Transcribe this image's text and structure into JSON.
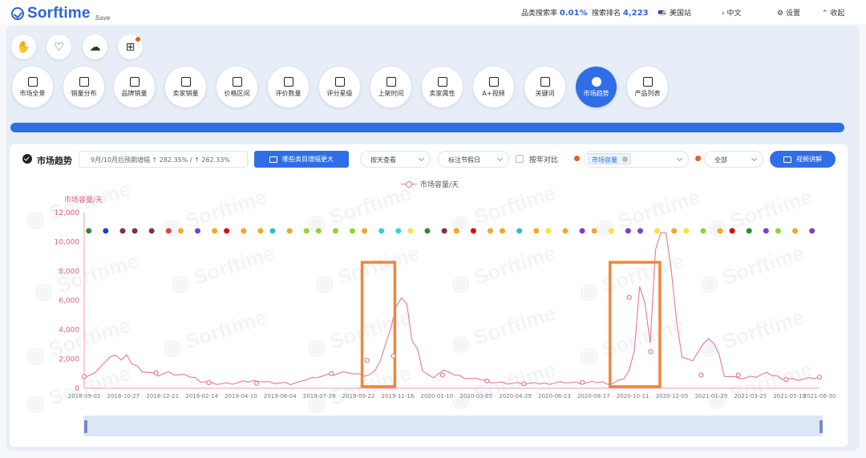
{
  "app": {
    "logo": "Sorftime",
    "logo_sub": "Save"
  },
  "topbar": {
    "search_rate_label": "品类搜索率",
    "search_rate_value": "0.01%",
    "search_rank_label": "搜索排名",
    "search_rank_value": "4,223",
    "site_label": "美国站",
    "lang_label": "中文",
    "settings_label": "设置",
    "collapse_label": "收起"
  },
  "nav": {
    "items": [
      {
        "label": "市场全景",
        "icon": "grid-icon"
      },
      {
        "label": "销量分布",
        "icon": "bar-chart-icon"
      },
      {
        "label": "品牌销量",
        "icon": "brand-shield-icon"
      },
      {
        "label": "卖家销量",
        "icon": "seller-icon"
      },
      {
        "label": "价格区间",
        "icon": "price-icon"
      },
      {
        "label": "评价数量",
        "icon": "review-icon"
      },
      {
        "label": "评分星级",
        "icon": "star-icon"
      },
      {
        "label": "上架时间",
        "icon": "calendar-icon"
      },
      {
        "label": "卖家属性",
        "icon": "store-icon"
      },
      {
        "label": "A+视频",
        "icon": "video-icon"
      },
      {
        "label": "关键词",
        "icon": "lock-icon"
      },
      {
        "label": "市场趋势",
        "icon": "trend-icon"
      },
      {
        "label": "产品列表",
        "icon": "list-icon"
      }
    ],
    "active_index": 11
  },
  "progress": {
    "value": 1.0
  },
  "card": {
    "title": "市场趋势",
    "info_text": "9月/10月后预期增幅 ↑ 282.35% / ↑ 262.33%",
    "growth_button": "哪些类目增幅更大",
    "granularity_select": "按天查看",
    "holiday_select": "标注节假日",
    "yoy_label": "按年对比",
    "metric_tag": "市场容量",
    "scope_select": "全部",
    "video_button": "视频讲解"
  },
  "chart_data": {
    "type": "line",
    "series": [
      {
        "name": "市场容量/天"
      }
    ],
    "ylabel": "市场容量/天",
    "ylim": [
      0,
      12000
    ],
    "yticks": [
      "0",
      "2,000",
      "4,000",
      "6,000",
      "8,000",
      "10,000",
      "12,000"
    ],
    "x_ticks": [
      "2018-09-02",
      "2018-10-27",
      "2018-12-21",
      "2019-02-14",
      "2019-04-10",
      "2019-06-04",
      "2019-07-29",
      "2019-09-22",
      "2019-11-16",
      "2020-01-10",
      "2020-03-05",
      "2020-04-29",
      "2020-06-23",
      "2020-08-17",
      "2020-10-11",
      "2020-12-05",
      "2021-01-29",
      "2021-03-25",
      "2021-05-19",
      "2021-06-30"
    ],
    "x_range": [
      "2018-09-02",
      "2021-06-30"
    ],
    "values": [
      800,
      900,
      1000,
      1500,
      1800,
      2100,
      2300,
      1900,
      2200,
      1700,
      1500,
      1200,
      1100,
      1000,
      900,
      1000,
      1050,
      950,
      900,
      850,
      800,
      700,
      500,
      450,
      350,
      330,
      300,
      300,
      320,
      350,
      420,
      450,
      500,
      550,
      450,
      400,
      380,
      350,
      330,
      300,
      350,
      400,
      600,
      700,
      800,
      850,
      900,
      950,
      1000,
      1050,
      1100,
      950,
      900,
      850,
      900,
      1300,
      1900,
      3000,
      4200,
      5600,
      6100,
      5800,
      3200,
      2600,
      1200,
      900,
      800,
      1000,
      1200,
      1150,
      900,
      800,
      700,
      650,
      600,
      600,
      500,
      450,
      400,
      380,
      350,
      330,
      320,
      310,
      300,
      300,
      320,
      330,
      350,
      380,
      400,
      420,
      380,
      350,
      330,
      350,
      380,
      420,
      400,
      350,
      350,
      500,
      700,
      1200,
      2500,
      7000,
      5800,
      3000,
      9500,
      10600,
      10700,
      8000,
      4500,
      2200,
      2000,
      1800,
      2500,
      3000,
      3300,
      3100,
      2300,
      900,
      800,
      750,
      700,
      700,
      750,
      800,
      900,
      1000,
      900,
      800,
      700,
      650,
      600,
      600,
      620,
      650,
      700,
      750
    ],
    "markers": [
      {
        "date": "2018-09-02",
        "value": 800
      },
      {
        "date": "2018-12-12",
        "value": 1050
      },
      {
        "date": "2019-02-24",
        "value": 380
      },
      {
        "date": "2019-05-02",
        "value": 330
      },
      {
        "date": "2019-08-15",
        "value": 1000
      },
      {
        "date": "2019-10-04",
        "value": 1900
      },
      {
        "date": "2019-11-10",
        "value": 2200
      },
      {
        "date": "2020-01-18",
        "value": 900
      },
      {
        "date": "2020-03-20",
        "value": 500
      },
      {
        "date": "2020-05-11",
        "value": 300
      },
      {
        "date": "2020-08-01",
        "value": 400
      },
      {
        "date": "2020-10-06",
        "value": 6200
      },
      {
        "date": "2020-11-05",
        "value": 2500
      },
      {
        "date": "2021-01-15",
        "value": 900
      },
      {
        "date": "2021-03-08",
        "value": 900
      },
      {
        "date": "2021-05-14",
        "value": 600
      },
      {
        "date": "2021-06-30",
        "value": 750
      }
    ],
    "event_colors": [
      "#2e8b2e",
      "#1f3fd1",
      "#8b2e2e",
      "#8b2e2e",
      "#8b2e2e",
      "#e04040",
      "#f5a623",
      "#7b3fd1",
      "#f5a623",
      "#e00000",
      "#f5a623",
      "#f5a623",
      "#2fbfbf",
      "#f5a623",
      "#8fd33a",
      "#8fd33a",
      "#8fd33a",
      "#8fd33a",
      "#f5a623",
      "#2fd3d3",
      "#2fd3d3",
      "#f5e53a",
      "#2e8b2e",
      "#8b2e2e",
      "#f5a623",
      "#e00000",
      "#f5a623",
      "#f5a623",
      "#2fbfbf",
      "#f5a623",
      "#f5e53a",
      "#f5a623",
      "#7b3fd1",
      "#f5a623",
      "#f5e53a",
      "#7b3fd1",
      "#7b3fd1",
      "#f5e53a",
      "#f5a623",
      "#f5e53a",
      "#8fd33a",
      "#f5a623",
      "#e00000",
      "#2e8b2e",
      "#7b3fd1",
      "#8fd33a",
      "#f5a623",
      "#7b3fd1"
    ],
    "highlights": [
      {
        "from": "2019-09-27",
        "to": "2019-11-12"
      },
      {
        "from": "2020-09-09",
        "to": "2020-11-18"
      }
    ],
    "colors": {
      "line": "#e57a92",
      "axis_text": "#e05a7a",
      "highlight": "#f0863a"
    }
  }
}
